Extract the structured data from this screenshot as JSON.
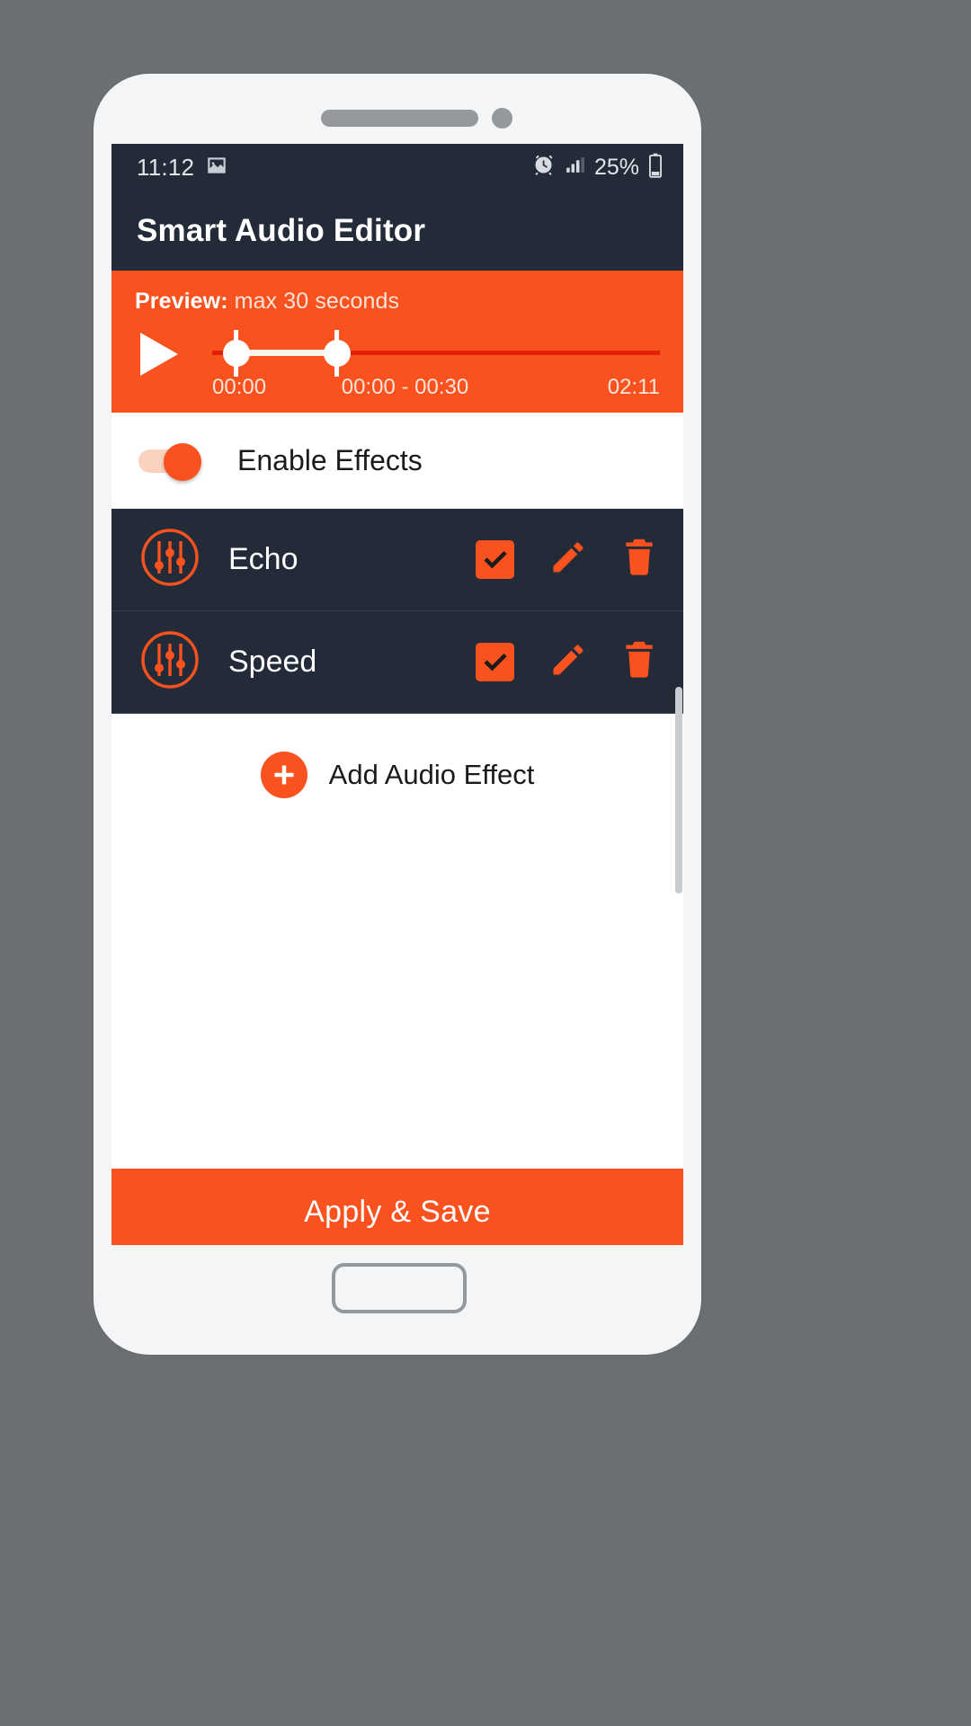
{
  "statusbar": {
    "time": "11:12",
    "battery_percent": "25%",
    "icons": {
      "photo": "image-icon",
      "alarm": "alarm-clock-icon",
      "signal": "signal-bars-icon",
      "battery": "battery-icon"
    }
  },
  "header": {
    "title": "Smart Audio Editor"
  },
  "preview": {
    "label_bold": "Preview:",
    "label_rest": " max 30 seconds",
    "play_icon": "play-icon",
    "start_time": "00:00",
    "range_time": "00:00 - 00:30",
    "total_time": "02:11",
    "accent_color": "#f9521f",
    "track_color": "#e21f08"
  },
  "enable_effects": {
    "label": "Enable Effects",
    "state": "on"
  },
  "effects": [
    {
      "name": "Echo",
      "icon": "equalizer-icon",
      "checked": true,
      "edit_icon": "pencil-icon",
      "delete_icon": "trash-icon"
    },
    {
      "name": "Speed",
      "icon": "equalizer-icon",
      "checked": true,
      "edit_icon": "pencil-icon",
      "delete_icon": "trash-icon"
    }
  ],
  "add_effect": {
    "label": "Add Audio Effect",
    "icon": "plus-circle-icon"
  },
  "footer": {
    "apply_label": "Apply & Save"
  },
  "theme": {
    "accent": "#f9521f",
    "dark": "#232b38",
    "background": "#6b6f73"
  }
}
